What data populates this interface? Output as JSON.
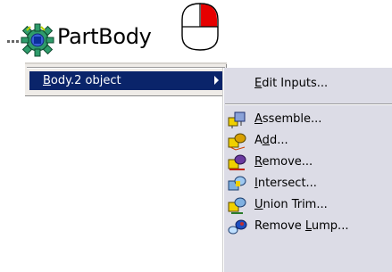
{
  "tree": {
    "node_label": "PartBody",
    "node_icon": "gear-body-icon",
    "mouse_icon": "right-mouse-button-icon"
  },
  "context_menu": {
    "items": [
      {
        "label": "Body.2 object",
        "mnemonic": "B",
        "has_submenu": true,
        "selected": true
      }
    ]
  },
  "submenu": {
    "items": [
      {
        "label": "Edit Inputs...",
        "mnemonic": "E",
        "icon": "none"
      },
      {
        "label": "Assemble...",
        "mnemonic": "A",
        "icon": "assemble-icon"
      },
      {
        "label": "Add...",
        "mnemonic": "d",
        "icon": "add-icon"
      },
      {
        "label": "Remove...",
        "mnemonic": "R",
        "icon": "remove-icon"
      },
      {
        "label": "Intersect...",
        "mnemonic": "I",
        "icon": "intersect-icon"
      },
      {
        "label": "Union Trim...",
        "mnemonic": "U",
        "icon": "union-trim-icon"
      },
      {
        "label": "Remove Lump...",
        "mnemonic": "L",
        "icon": "remove-lump-icon"
      }
    ]
  },
  "colors": {
    "selection": "#0a246a",
    "menu_bg": "#efece8",
    "submenu_bg": "#dcdce6",
    "mouse_button_active": "#e60000"
  }
}
